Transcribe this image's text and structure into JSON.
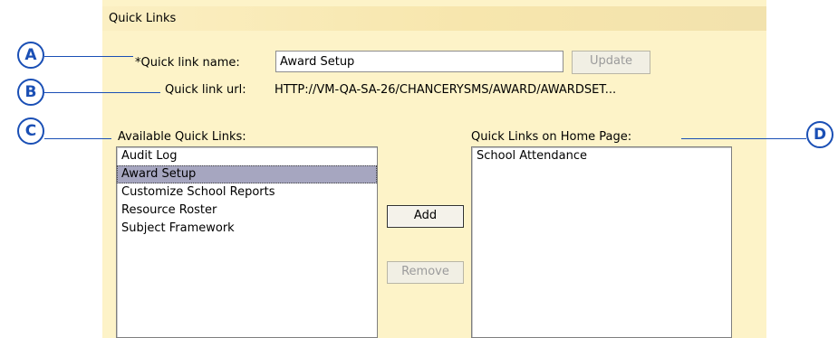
{
  "header": {
    "title": "Quick Links"
  },
  "form": {
    "name_label": "*Quick link name:",
    "name_value": "Award Setup",
    "update_label": "Update",
    "url_label": "Quick link url:",
    "url_value": "HTTP://VM-QA-SA-26/CHANCERYSMS/AWARD/AWARDSET..."
  },
  "available": {
    "label": "Available Quick Links:",
    "items": [
      "Audit Log",
      "Award Setup",
      "Customize School Reports",
      "Resource Roster",
      "Subject Framework"
    ],
    "selected": "Award Setup"
  },
  "home": {
    "label": "Quick Links on Home Page:",
    "items": [
      "School Attendance"
    ]
  },
  "actions": {
    "add_label": "Add",
    "remove_label": "Remove"
  },
  "callouts": {
    "a": "A",
    "b": "B",
    "c": "C",
    "d": "D"
  },
  "colors": {
    "panel_bg": "#fdf3c8",
    "header_bg": "#f7e6ad",
    "callout": "#1a4fb5",
    "selection": "#a6a6c0"
  }
}
